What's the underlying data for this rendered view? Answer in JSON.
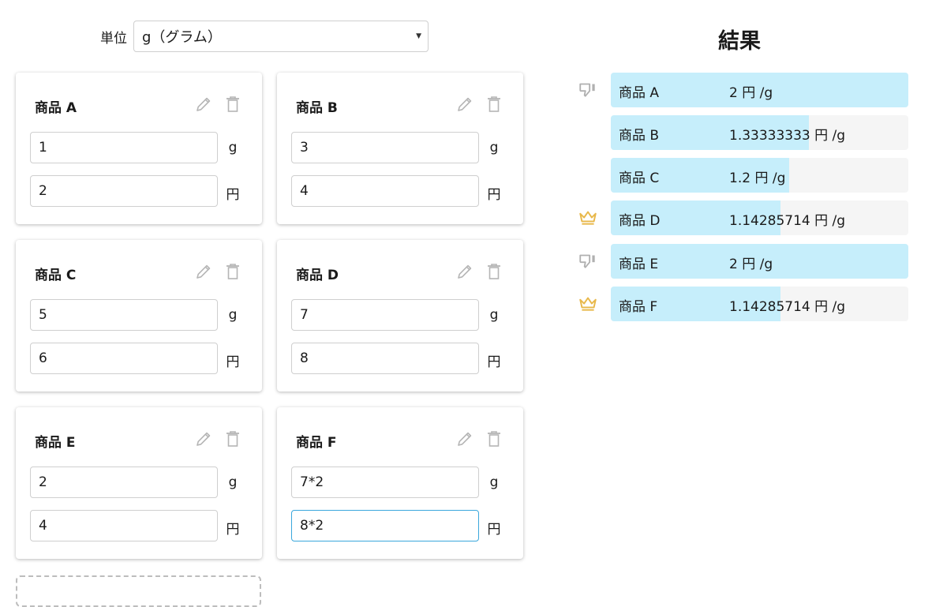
{
  "unit": {
    "label": "単位",
    "selected": "g（グラム）"
  },
  "products": [
    {
      "name": "商品 A",
      "quantity": "1",
      "quantity_unit": "g",
      "price": "2",
      "price_unit": "円"
    },
    {
      "name": "商品 B",
      "quantity": "3",
      "quantity_unit": "g",
      "price": "4",
      "price_unit": "円"
    },
    {
      "name": "商品 C",
      "quantity": "5",
      "quantity_unit": "g",
      "price": "6",
      "price_unit": "円"
    },
    {
      "name": "商品 D",
      "quantity": "7",
      "quantity_unit": "g",
      "price": "8",
      "price_unit": "円"
    },
    {
      "name": "商品 E",
      "quantity": "2",
      "quantity_unit": "g",
      "price": "4",
      "price_unit": "円"
    },
    {
      "name": "商品 F",
      "quantity": "7*2",
      "quantity_unit": "g",
      "price": "8*2",
      "price_unit": "円"
    }
  ],
  "results": {
    "title": "結果",
    "rows": [
      {
        "name": "商品 A",
        "value": "2 円 /g",
        "ratio": 1.0,
        "badge": "thumbs-down-icon"
      },
      {
        "name": "商品 B",
        "value": "1.33333333 円 /g",
        "ratio": 0.667,
        "badge": ""
      },
      {
        "name": "商品 C",
        "value": "1.2 円 /g",
        "ratio": 0.6,
        "badge": ""
      },
      {
        "name": "商品 D",
        "value": "1.14285714 円 /g",
        "ratio": 0.571,
        "badge": "crown-icon"
      },
      {
        "name": "商品 E",
        "value": "2 円 /g",
        "ratio": 1.0,
        "badge": "thumbs-down-icon"
      },
      {
        "name": "商品 F",
        "value": "1.14285714 円 /g",
        "ratio": 0.571,
        "badge": "crown-icon"
      }
    ]
  },
  "colors": {
    "bar_fill": "#c6eefb",
    "bar_bg": "#f5f5f5",
    "crown": "#e8b84a",
    "thumb": "#b0b0b0",
    "focus": "#3aa7dc"
  }
}
